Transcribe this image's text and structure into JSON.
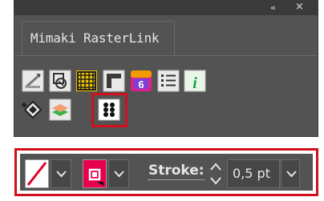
{
  "window": {
    "title": "Mimaki RasterLink",
    "collapse_glyph": "«",
    "close_glyph": "×"
  },
  "toolbar_icons": [
    "cut-icon",
    "frame-icon",
    "grid-icon",
    "corner-icon",
    "app-icon",
    "list-icon",
    "info-icon",
    "fill-icon",
    "layers-icon",
    "grid-dots-icon"
  ],
  "stroke_bar": {
    "label": "Stroke:",
    "value": "0,5 pt"
  },
  "colors": {
    "panel": "#535353",
    "highlight": "#d0101a",
    "fill_swatch": "#e8004f",
    "info": "#1aa24a"
  }
}
